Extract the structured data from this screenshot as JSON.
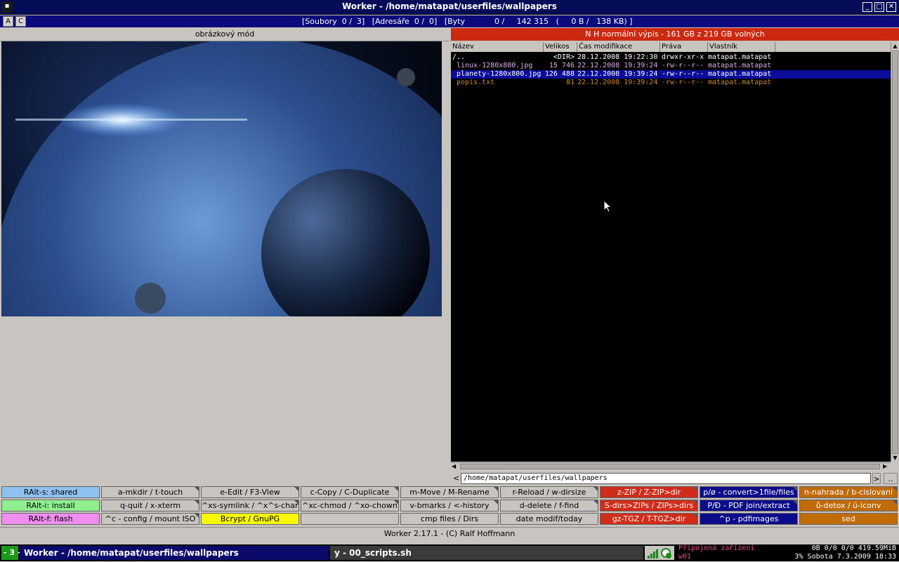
{
  "window": {
    "title": "Worker - /home/matapat/userfiles/wallpapers",
    "menu_glyph": "▪",
    "min_glyph": "_",
    "max_glyph": "□",
    "close_glyph": "✕"
  },
  "statusbar": {
    "btn_a": "A",
    "btn_c": "C",
    "stats": "[Soubory  0 /  3]   [Adresáře  0 /  0]   [Byty            0 /     142 315   (     0 B /   138 KB) ]"
  },
  "left_panel": {
    "mode_label": "obrázkový mód"
  },
  "right_panel": {
    "header": "N  H       normální výpis - 161 GB z 219 GB volných",
    "columns": [
      "Název",
      "Velikos",
      "Čas modifikace",
      "Práva",
      "Vlastník"
    ],
    "rows": [
      {
        "name": "/..",
        "size": "<DIR>",
        "time": "28.12.2008 19:22:30",
        "perms": "drwxr-xr-x",
        "owner": "matapat.matapat",
        "color": "#ffffff",
        "bg": "#000000"
      },
      {
        "name": " linux-1280x800.jpg",
        "size": "15 746",
        "time": "22.12.2008 19:39:24",
        "perms": "-rw-r--r--",
        "owner": "matapat.matapat",
        "color": "#e0a8e8",
        "bg": "#000000"
      },
      {
        "name": " planety-1280x800.jpg",
        "size": "126 488",
        "time": "22.12.2008 19:39:24",
        "perms": "-rw-r--r--",
        "owner": "matapat.matapat",
        "color": "#ffffff",
        "bg": "#0c0c9a"
      },
      {
        "name": " popis.txt",
        "size": "81",
        "time": "22.12.2008 19:39:24",
        "perms": "-rw-r--r--",
        "owner": "matapat.matapat",
        "color": "#c88a2a",
        "bg": "#000000"
      }
    ],
    "path": "/home/matapat/userfiles/wallpapers",
    "path_left_glyph": "<",
    "path_right_glyph": ">",
    "path_dots": ".."
  },
  "buttons": [
    [
      {
        "label": "RAlt-s: shared",
        "bg": "#8ec0f0",
        "color": "#000000"
      },
      {
        "label": "a-mkdir / t-touch",
        "bg": "#c8c5c0",
        "color": "#000000",
        "corner": true
      },
      {
        "label": "e-Edit / F3-View",
        "bg": "#c8c5c0",
        "color": "#000000",
        "corner": true
      },
      {
        "label": "c-Copy / C-Duplicate",
        "bg": "#c8c5c0",
        "color": "#000000",
        "corner": true
      },
      {
        "label": "m-Move / M-Rename",
        "bg": "#c8c5c0",
        "color": "#000000",
        "corner": true
      },
      {
        "label": "r-Reload / w-dirsize",
        "bg": "#c8c5c0",
        "color": "#000000",
        "corner": true
      },
      {
        "label": "z-ZIP / Z-ZIP>dir",
        "bg": "#d02c1a",
        "color": "#ffffff",
        "corner": true
      },
      {
        "label": "p/ø - convert>1file/files",
        "bg": "#0c0c8a",
        "color": "#ffffff",
        "corner": true
      },
      {
        "label": "n-nahrada / b-cislovani",
        "bg": "#c06a08",
        "color": "#ffffff",
        "corner": true
      }
    ],
    [
      {
        "label": "RAlt-i: install",
        "bg": "#8ef08e",
        "color": "#000000"
      },
      {
        "label": "q-quit / x-xterm",
        "bg": "#c8c5c0",
        "color": "#000000",
        "corner": true
      },
      {
        "label": "^xs-symlink / ^x^s-chang",
        "bg": "#c8c5c0",
        "color": "#000000",
        "corner": true
      },
      {
        "label": "^xc-chmod / ^xo-chown",
        "bg": "#c8c5c0",
        "color": "#000000",
        "corner": true
      },
      {
        "label": "v-bmarks / <-history",
        "bg": "#c8c5c0",
        "color": "#000000",
        "corner": true
      },
      {
        "label": "d-delete / f-find",
        "bg": "#c8c5c0",
        "color": "#000000",
        "corner": true
      },
      {
        "label": "S-dirs>ZIPs / ZIPs>dirs",
        "bg": "#d02c1a",
        "color": "#ffffff",
        "corner": true
      },
      {
        "label": "P/Ð - PDF join/extract",
        "bg": "#0c0c8a",
        "color": "#ffffff",
        "corner": true
      },
      {
        "label": "ů-detox / ú-iconv",
        "bg": "#c06a08",
        "color": "#ffffff",
        "corner": true
      }
    ],
    [
      {
        "label": "RAlt-f: flash",
        "bg": "#f08ef0",
        "color": "#000000"
      },
      {
        "label": "^c - config / mount ISO",
        "bg": "#c8c5c0",
        "color": "#000000",
        "corner": true
      },
      {
        "label": "Bcrypt / GnuPG",
        "bg": "#f8f800",
        "color": "#000000"
      },
      {
        "label": "",
        "bg": "#c8c5c0",
        "color": "#000000"
      },
      {
        "label": "cmp files / Dirs",
        "bg": "#c8c5c0",
        "color": "#000000"
      },
      {
        "label": "date modif/today",
        "bg": "#c8c5c0",
        "color": "#000000"
      },
      {
        "label": "gz-TGZ / T-TGZ>dir",
        "bg": "#d02c1a",
        "color": "#ffffff",
        "corner": true
      },
      {
        "label": "^p - pdfimages",
        "bg": "#0c0c8a",
        "color": "#ffffff"
      },
      {
        "label": "sed",
        "bg": "#c06a08",
        "color": "#ffffff"
      }
    ]
  ],
  "footer": "Worker 2.17.1 - (C) Ralf Hoffmann",
  "taskbar": {
    "workspace": "- 3 -",
    "task1": "Worker - /home/matapat/userfiles/wallpapers",
    "task2": "y - 00_scripts.sh",
    "devices_line1": "Připojená zařízení",
    "devices_line2": "w01",
    "stats_line1": "0B   0/0   0/0   419.59MiB",
    "stats_line2": "3%  Sobota 7.3.2009 18:33",
    "accent": "#1a9a1a"
  }
}
